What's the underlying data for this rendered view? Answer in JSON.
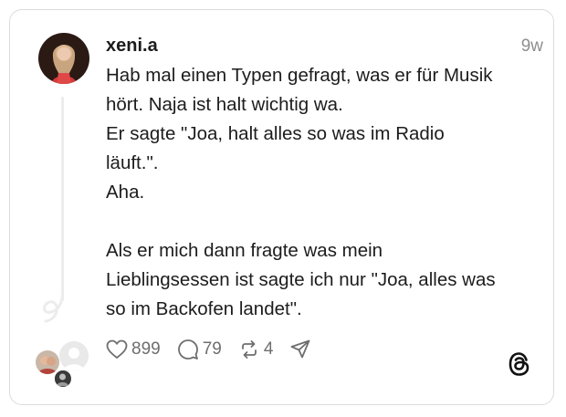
{
  "post": {
    "username": "xeni.a",
    "time": "9w",
    "lines": [
      "Hab mal einen Typen gefragt, was er für Musik",
      "hört. Naja ist halt wichtig wa.",
      "Er sagte \"Joa, halt alles so was im Radio",
      "läuft.\".",
      "Aha.",
      "",
      "Als er mich dann fragte was mein",
      "Lieblingsessen ist sagte ich nur \"Joa, alles was",
      "so im Backofen landet\"."
    ]
  },
  "actions": {
    "likes": "899",
    "replies": "79",
    "reposts": "4"
  },
  "icons": {
    "like": "heart-icon",
    "reply": "comment-bubble-icon",
    "repost": "repost-icon",
    "share": "send-icon",
    "logo": "threads-logo-icon"
  }
}
